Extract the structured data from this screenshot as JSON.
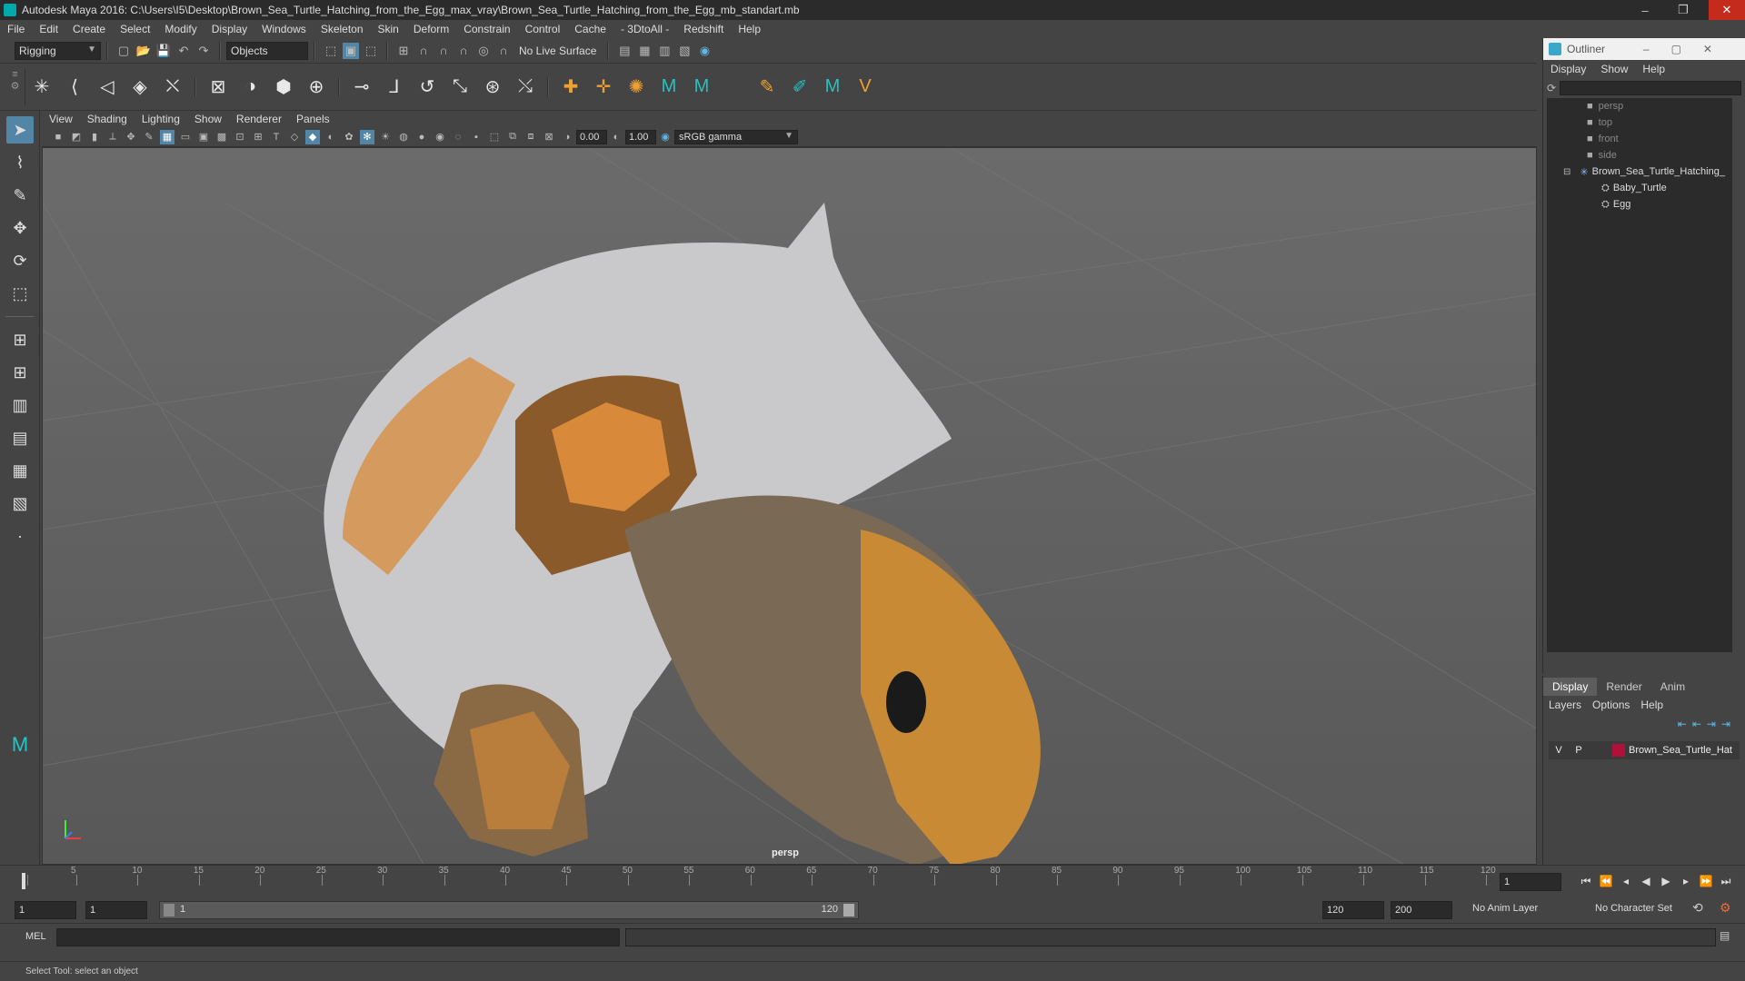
{
  "window": {
    "title": "Autodesk Maya 2016: C:\\Users\\I5\\Desktop\\Brown_Sea_Turtle_Hatching_from_the_Egg_max_vray\\Brown_Sea_Turtle_Hatching_from_the_Egg_mb_standart.mb",
    "min_icon": "–",
    "restore_icon": "❐",
    "close_icon": "✕"
  },
  "menubar": [
    "File",
    "Edit",
    "Create",
    "Select",
    "Modify",
    "Display",
    "Windows",
    "Skeleton",
    "Skin",
    "Deform",
    "Constrain",
    "Control",
    "Cache",
    "- 3DtoAll -",
    "Redshift",
    "Help"
  ],
  "statusline": {
    "mode": "Rigging",
    "select_mode": "Objects",
    "live_surface": "No Live Surface"
  },
  "panel": {
    "menu": [
      "View",
      "Shading",
      "Lighting",
      "Show",
      "Renderer",
      "Panels"
    ],
    "exposure": "0.00",
    "gamma": "1.00",
    "colorspace": "sRGB gamma",
    "camera_label": "persp"
  },
  "outliner": {
    "title": "Outliner",
    "menu": [
      "Display",
      "Show",
      "Help"
    ],
    "items": [
      {
        "label": "persp"
      },
      {
        "label": "top"
      },
      {
        "label": "front"
      },
      {
        "label": "side"
      },
      {
        "label": "Brown_Sea_Turtle_Hatching_"
      },
      {
        "label": "Baby_Turtle"
      },
      {
        "label": "Egg"
      }
    ]
  },
  "layer_editor": {
    "tabs": [
      "Display",
      "Render",
      "Anim"
    ],
    "menu": [
      "Layers",
      "Options",
      "Help"
    ],
    "layer": {
      "v": "V",
      "p": "P",
      "name": "Brown_Sea_Turtle_Hat",
      "color": "#b0103a"
    }
  },
  "timeline": {
    "ticks": [
      "1",
      "5",
      "10",
      "15",
      "20",
      "25",
      "30",
      "35",
      "40",
      "45",
      "50",
      "55",
      "60",
      "65",
      "70",
      "75",
      "80",
      "85",
      "90",
      "95",
      "100",
      "105",
      "110",
      "115",
      "120"
    ],
    "current_frame": "1"
  },
  "range": {
    "start": "1",
    "start_inner": "1",
    "slider_start": "1",
    "slider_end": "120",
    "end_inner": "120",
    "end": "200",
    "anim_layer": "No Anim Layer",
    "char_set": "No Character Set"
  },
  "cmdline": {
    "label": "MEL"
  },
  "helpline": {
    "text": "Select Tool: select an object"
  }
}
